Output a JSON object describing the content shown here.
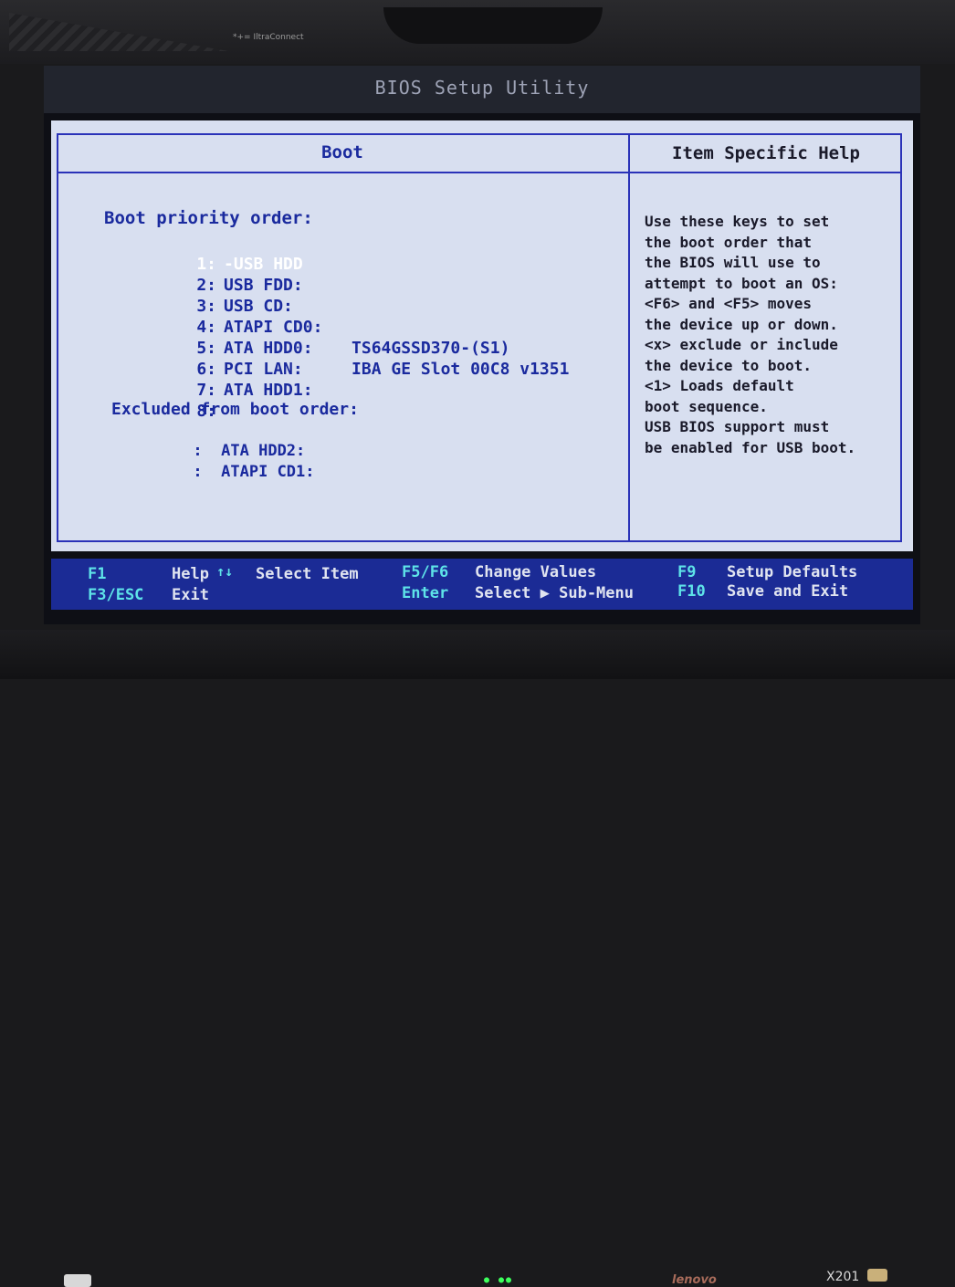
{
  "bezel": {
    "sticker": "*+= IltraConnect",
    "brand": "lenovo",
    "model": "X201"
  },
  "window": {
    "title": "BIOS Setup Utility"
  },
  "panel_left": {
    "header": "Boot"
  },
  "panel_right": {
    "header": "Item Specific Help"
  },
  "boot_priority": {
    "title": "Boot priority order:",
    "items": [
      {
        "num": "1:",
        "label": "-USB HDD",
        "value": "",
        "selected": true
      },
      {
        "num": "2:",
        "label": "USB FDD:",
        "value": ""
      },
      {
        "num": "3:",
        "label": "USB CD:",
        "value": ""
      },
      {
        "num": "4:",
        "label": "ATAPI CD0:",
        "value": ""
      },
      {
        "num": "5:",
        "label": "ATA HDD0:",
        "value": "TS64GSSD370-(S1)"
      },
      {
        "num": "6:",
        "label": "PCI LAN:",
        "value": "IBA GE Slot 00C8 v1351"
      },
      {
        "num": "7:",
        "label": "ATA HDD1:",
        "value": ""
      },
      {
        "num": "8:",
        "label": "",
        "value": ""
      }
    ]
  },
  "excluded": {
    "title": "Excluded from boot order:",
    "items": [
      {
        "num": ":",
        "label": "ATA HDD2:"
      },
      {
        "num": ":",
        "label": "ATAPI CD1:"
      }
    ]
  },
  "help": {
    "lines": [
      "Use these keys to set",
      "the boot order that",
      "the BIOS will use to",
      "attempt to boot an OS:",
      "<F6> and <F5> moves",
      "the device up or down.",
      "<x> exclude or include",
      "the device to boot.",
      "<1> Loads default",
      "boot sequence.",
      "USB BIOS support must",
      "be enabled for USB boot."
    ]
  },
  "footer": {
    "f1_key": "F1",
    "f1_action": "Help",
    "arrows_key": "↑↓",
    "arrows_action": "Select Item",
    "f5f6_key": "F5/F6",
    "f5f6_action": "Change Values",
    "f9_key": "F9",
    "f9_action": "Setup Defaults",
    "esc_key": "F3/ESC",
    "esc_action": "Exit",
    "enter_key": "Enter",
    "enter_action": "Select ▶ Sub-Menu",
    "f10_key": "F10",
    "f10_action": "Save and Exit"
  },
  "colors": {
    "accent_blue": "#1a2a9e",
    "key_cyan": "#5ee3e8",
    "panel_bg": "#d8dff0",
    "footer_bg": "#1b2b95"
  }
}
